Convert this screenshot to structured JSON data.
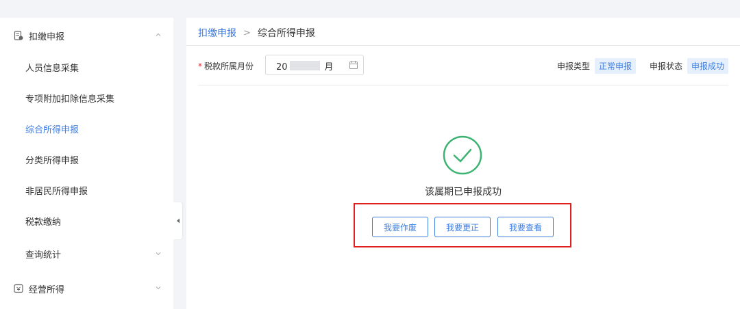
{
  "sidebar": {
    "group1": {
      "label": "扣缴申报",
      "icon": "document-icon"
    },
    "items": [
      {
        "label": "人员信息采集"
      },
      {
        "label": "专项附加扣除信息采集"
      },
      {
        "label": "综合所得申报"
      },
      {
        "label": "分类所得申报"
      },
      {
        "label": "非居民所得申报"
      },
      {
        "label": "税款缴纳"
      },
      {
        "label": "查询统计"
      }
    ],
    "active_item": "综合所得申报",
    "group2": {
      "label": "经营所得",
      "icon": "shop-icon"
    }
  },
  "breadcrumb": {
    "parent": "扣缴申报",
    "separator": ">",
    "current": "综合所得申报"
  },
  "filter": {
    "month_label": "税款所属月份",
    "required_mark": "*",
    "month_value_prefix": "20",
    "month_value_suffix": "月"
  },
  "status": {
    "type_label": "申报类型",
    "type_value": "正常申报",
    "state_label": "申报状态",
    "state_value": "申报成功"
  },
  "result": {
    "message": "该属期已申报成功",
    "icon": "check-circle-icon"
  },
  "actions": {
    "void_label": "我要作废",
    "correct_label": "我要更正",
    "view_label": "我要查看"
  },
  "colors": {
    "accent": "#3d7de0",
    "success": "#3cb371",
    "highlight_box": "#e02020"
  }
}
